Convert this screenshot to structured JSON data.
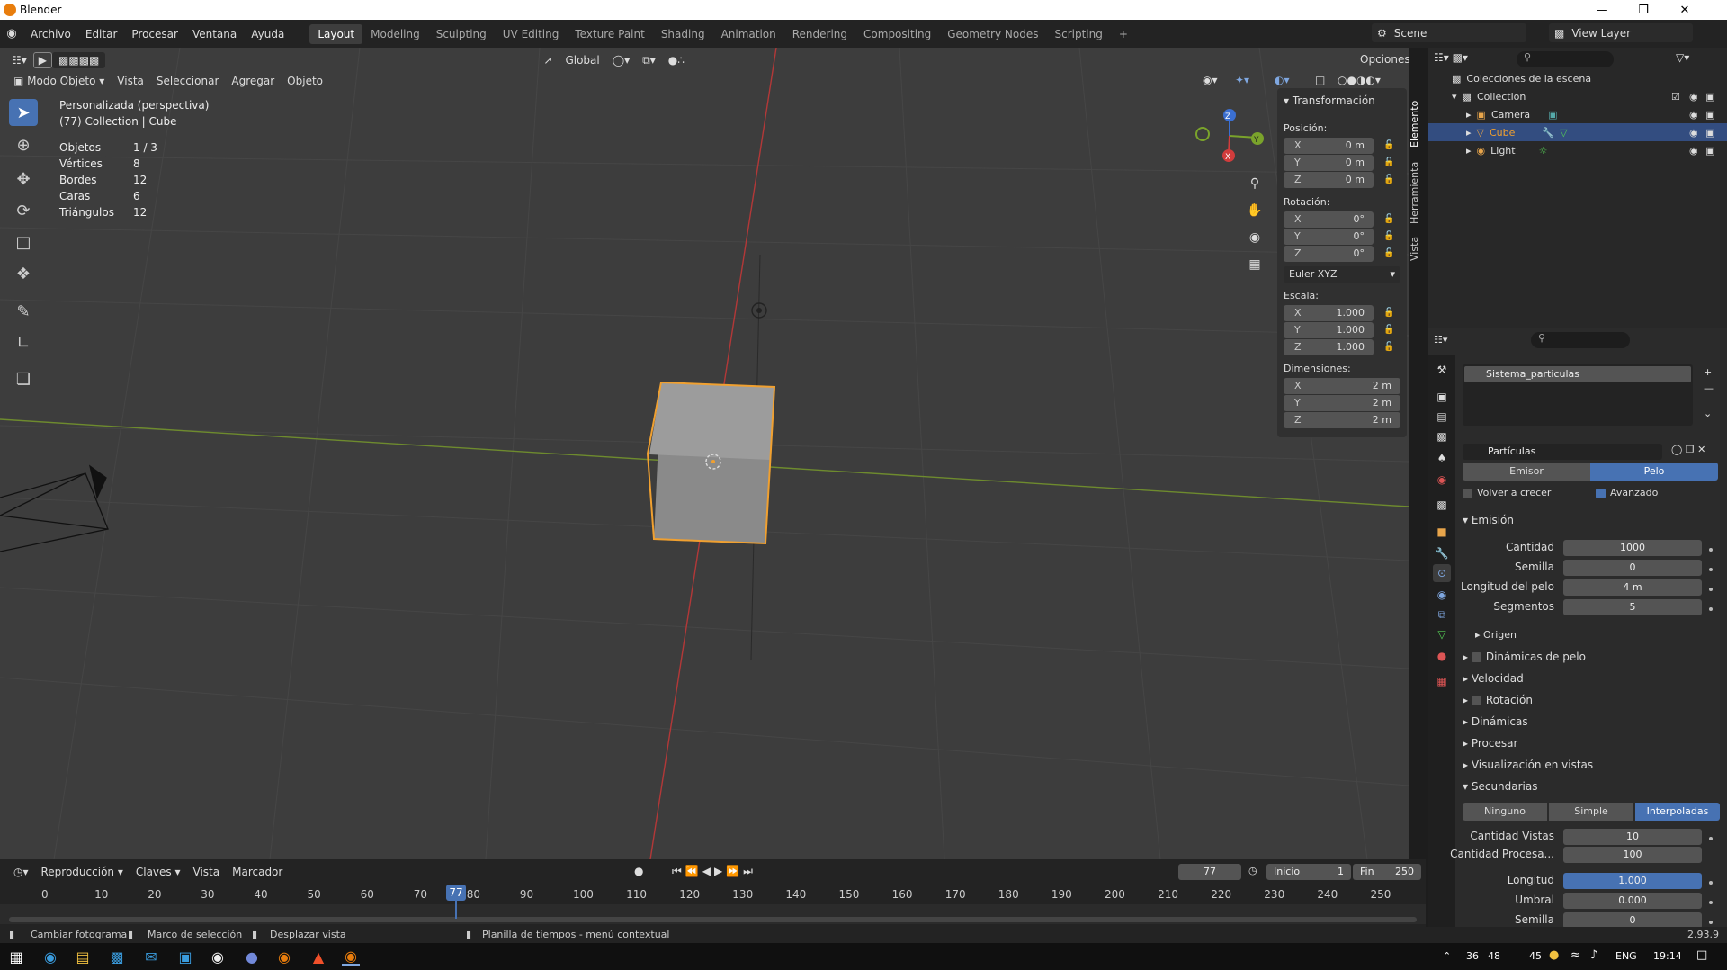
{
  "window": {
    "title": "Blender"
  },
  "topbar": {
    "menus": [
      "Archivo",
      "Editar",
      "Procesar",
      "Ventana",
      "Ayuda"
    ],
    "workspaces": [
      "Layout",
      "Modeling",
      "Sculpting",
      "UV Editing",
      "Texture Paint",
      "Shading",
      "Animation",
      "Rendering",
      "Compositing",
      "Geometry Nodes",
      "Scripting"
    ],
    "active_workspace": "Layout",
    "scene": "Scene",
    "view_layer": "View Layer"
  },
  "viewport": {
    "transform_orientation": "Global",
    "options": "Opciones",
    "mode": "Modo Objeto",
    "menus": [
      "Vista",
      "Seleccionar",
      "Agregar",
      "Objeto"
    ],
    "view_name": "Personalizada (perspectiva)",
    "collection_info": "(77) Collection | Cube",
    "stats": [
      {
        "label": "Objetos",
        "value": "1 / 3"
      },
      {
        "label": "Vértices",
        "value": "8"
      },
      {
        "label": "Bordes",
        "value": "12"
      },
      {
        "label": "Caras",
        "value": "6"
      },
      {
        "label": "Triángulos",
        "value": "12"
      }
    ],
    "gizmo": {
      "x": "X",
      "y": "Y",
      "z": "Z"
    }
  },
  "npanel": {
    "title": "Transformación",
    "position_label": "Posición:",
    "position": [
      {
        "axis": "X",
        "value": "0 m"
      },
      {
        "axis": "Y",
        "value": "0 m"
      },
      {
        "axis": "Z",
        "value": "0 m"
      }
    ],
    "rotation_label": "Rotación:",
    "rotation": [
      {
        "axis": "X",
        "value": "0°"
      },
      {
        "axis": "Y",
        "value": "0°"
      },
      {
        "axis": "Z",
        "value": "0°"
      }
    ],
    "rotation_mode": "Euler XYZ",
    "scale_label": "Escala:",
    "scale": [
      {
        "axis": "X",
        "value": "1.000"
      },
      {
        "axis": "Y",
        "value": "1.000"
      },
      {
        "axis": "Z",
        "value": "1.000"
      }
    ],
    "dimensions_label": "Dimensiones:",
    "dimensions": [
      {
        "axis": "X",
        "value": "2 m"
      },
      {
        "axis": "Y",
        "value": "2 m"
      },
      {
        "axis": "Z",
        "value": "2 m"
      }
    ],
    "tabs": [
      "Elemento",
      "Herramienta",
      "Vista"
    ]
  },
  "outliner": {
    "root": "Colecciones de la escena",
    "collection": "Collection",
    "items": [
      "Camera",
      "Cube",
      "Light"
    ],
    "selected": "Cube"
  },
  "properties": {
    "particle_system": "Sistema_particulas",
    "settings_name": "Partículas",
    "type_options": [
      "Emisor",
      "Pelo"
    ],
    "active_type": "Pelo",
    "regrow_label": "Volver a crecer",
    "advanced_label": "Avanzado",
    "emission": {
      "title": "Emisión",
      "fields": [
        {
          "label": "Cantidad",
          "value": "1000"
        },
        {
          "label": "Semilla",
          "value": "0"
        },
        {
          "label": "Longitud del pelo",
          "value": "4 m"
        },
        {
          "label": "Segmentos",
          "value": "5"
        }
      ],
      "origin": "Origen"
    },
    "sections": [
      "Dinámicas de pelo",
      "Velocidad",
      "Rotación",
      "Dinámicas",
      "Procesar",
      "Visualización en vistas"
    ],
    "children": {
      "title": "Secundarias",
      "modes": [
        "Ninguno",
        "Simple",
        "Interpoladas"
      ],
      "active_mode": "Interpoladas",
      "fields": [
        {
          "label": "Cantidad Vistas",
          "value": "10"
        },
        {
          "label": "Cantidad Procesa...",
          "value": "100"
        }
      ],
      "fields2": [
        {
          "label": "Longitud",
          "value": "1.000"
        },
        {
          "label": "Umbral",
          "value": "0.000"
        },
        {
          "label": "Semilla",
          "value": "0"
        }
      ]
    }
  },
  "timeline": {
    "menus": [
      "Reproducción",
      "Claves",
      "Vista",
      "Marcador"
    ],
    "current_frame": "77",
    "start_label": "Inicio",
    "start": "1",
    "end_label": "Fin",
    "end": "250",
    "ticks": [
      "0",
      "10",
      "20",
      "30",
      "40",
      "50",
      "60",
      "70",
      "80",
      "90",
      "100",
      "110",
      "120",
      "130",
      "140",
      "150",
      "160",
      "170",
      "180",
      "190",
      "200",
      "210",
      "220",
      "230",
      "240",
      "250"
    ]
  },
  "statusbar": {
    "items": [
      "Cambiar fotograma",
      "Marco de selección",
      "Desplazar vista",
      "Planilla de tiempos - menú contextual"
    ],
    "version": "2.93.9"
  },
  "taskbar": {
    "tray": [
      "36",
      "48",
      "45",
      "ENG"
    ],
    "time": "19:14"
  }
}
